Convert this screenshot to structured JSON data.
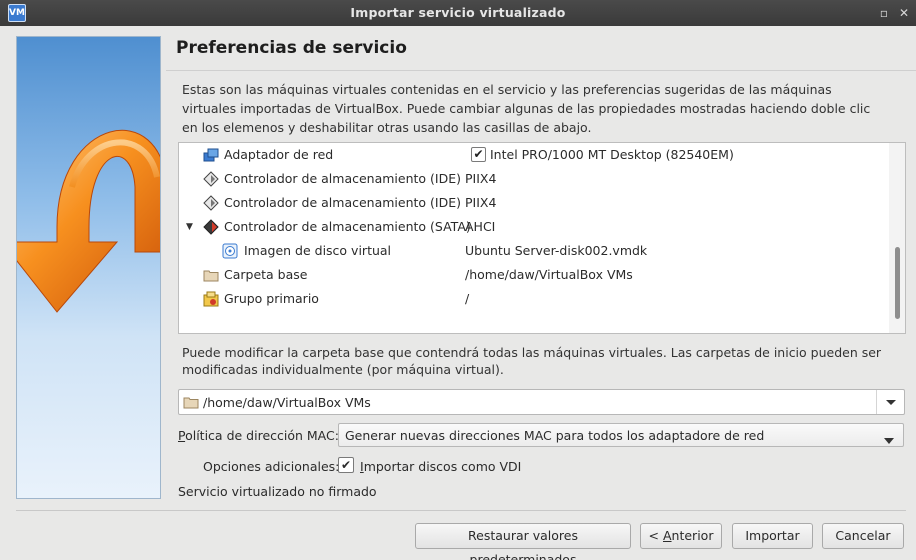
{
  "window": {
    "title": "Importar servicio virtualizado",
    "app_icon_text": "VM",
    "restore_glyph": "▫",
    "close_glyph": "✕"
  },
  "page": {
    "title": "Preferencias de servicio",
    "intro": "Estas son las máquinas virtuales contenidas en el servicio y las preferencias sugeridas de las máquinas virtuales importadas de VirtualBox. Puede cambiar algunas de las propiedades mostradas haciendo doble clic en los elemenos y deshabilitar otras usando las casillas de abajo."
  },
  "tree": {
    "rows": [
      {
        "label": "Adaptador de red",
        "value": "Intel PRO/1000 MT Desktop (82540EM)",
        "icon": "network-adapter-icon",
        "checked": true
      },
      {
        "label": "Controlador de almacenamiento (IDE)",
        "value": "PIIX4",
        "icon": "ide-controller-icon"
      },
      {
        "label": "Controlador de almacenamiento (IDE)",
        "value": "PIIX4",
        "icon": "ide-controller-icon"
      },
      {
        "label": "Controlador de almacenamiento (SATA)",
        "value": "AHCI",
        "icon": "sata-controller-icon",
        "expanded": true
      },
      {
        "label": "Imagen de disco virtual",
        "value": "Ubuntu Server-disk002.vmdk",
        "icon": "virtual-disk-icon",
        "child": true
      },
      {
        "label": "Carpeta base",
        "value": "/home/daw/VirtualBox VMs",
        "icon": "folder-icon"
      },
      {
        "label": "Grupo primario",
        "value": "/",
        "icon": "group-icon"
      }
    ],
    "expander_glyph": "▼"
  },
  "base_folder": {
    "description": "Puede modificar la carpeta base que contendrá todas las máquinas virtuales. Las carpetas de inicio pueden ser modificadas individualmente (por máquina virtual).",
    "value": "/home/daw/VirtualBox VMs"
  },
  "mac_policy": {
    "label_first": "P",
    "label_rest": "olítica de dirección MAC:",
    "value": "Generar nuevas direcciones MAC para todos los adaptadore de red"
  },
  "options": {
    "label": "Opciones adicionales:",
    "import_vdi_first": "I",
    "import_vdi_rest": "mportar discos como VDI",
    "import_vdi_checked": true
  },
  "signature": "Servicio virtualizado no firmado",
  "check_glyph": "✔",
  "buttons": {
    "restore": "Restaurar valores predeterminados",
    "back_prefix": "< ",
    "back_mnemonic": "A",
    "back_rest": "nterior",
    "import": "Importar",
    "cancel": "Cancelar"
  },
  "colors": {
    "accent_orange": "#f07a12",
    "selection_blue": "#3b7bd0"
  }
}
